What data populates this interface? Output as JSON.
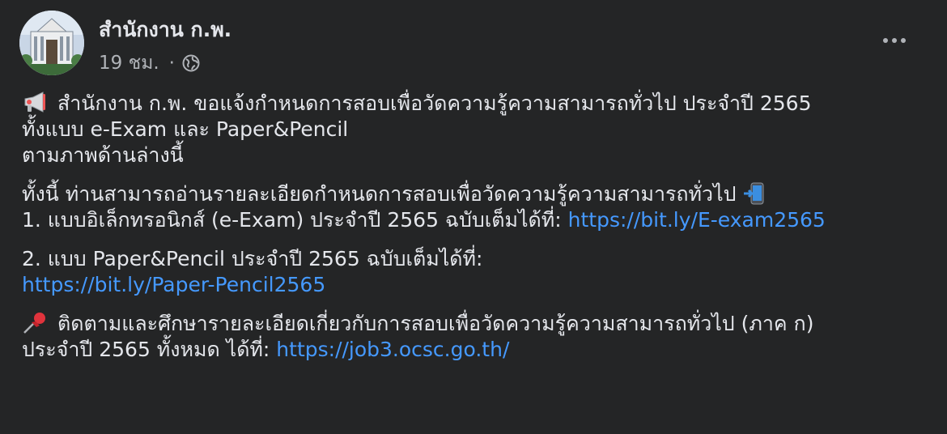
{
  "post": {
    "author": "สำนักงาน ก.พ.",
    "time": "19 ชม.",
    "separator": "·",
    "audience_icon": "globe-icon",
    "more_icon": "more-options-icon",
    "paragraphs": {
      "p1": {
        "icon": "megaphone-icon",
        "line1": "สำนักงาน ก.พ. ขอแจ้งกำหนดการสอบเพื่อวัดความรู้ความสามารถทั่วไป ประจำปี 2565",
        "line2": "ทั้งแบบ e-Exam และ Paper&Pencil",
        "line3": "ตามภาพด้านล่างนี้"
      },
      "p2": {
        "line1": "ทั้งนี้ ท่านสามารถอ่านรายละเอียดกำหนดการสอบเพื่อวัดความรู้ความสามารถทั่วไป",
        "line1_icon": "mobile-phone-arrow-icon",
        "line2_text": "1. แบบอิเล็กทรอนิกส์ (e-Exam) ประจำปี 2565 ฉบับเต็มได้ที่: ",
        "line2_link": "https://bit.ly/E-exam2565"
      },
      "p3": {
        "line1": "2. แบบ Paper&Pencil ประจำปี 2565 ฉบับเต็มได้ที่:",
        "link": "https://bit.ly/Paper-Pencil2565"
      },
      "p4": {
        "icon": "pushpin-icon",
        "line1": "ติดตามและศึกษารายละเอียดเกี่ยวกับการสอบเพื่อวัดความรู้ความสามารถทั่วไป (ภาค ก)",
        "line2_text": "ประจำปี 2565 ทั้งหมด ได้ที่: ",
        "line2_link": "https://job3.ocsc.go.th/"
      }
    }
  },
  "colors": {
    "background": "#242526",
    "text": "#e4e6eb",
    "secondary_text": "#b0b3b8",
    "link": "#4599ff"
  }
}
